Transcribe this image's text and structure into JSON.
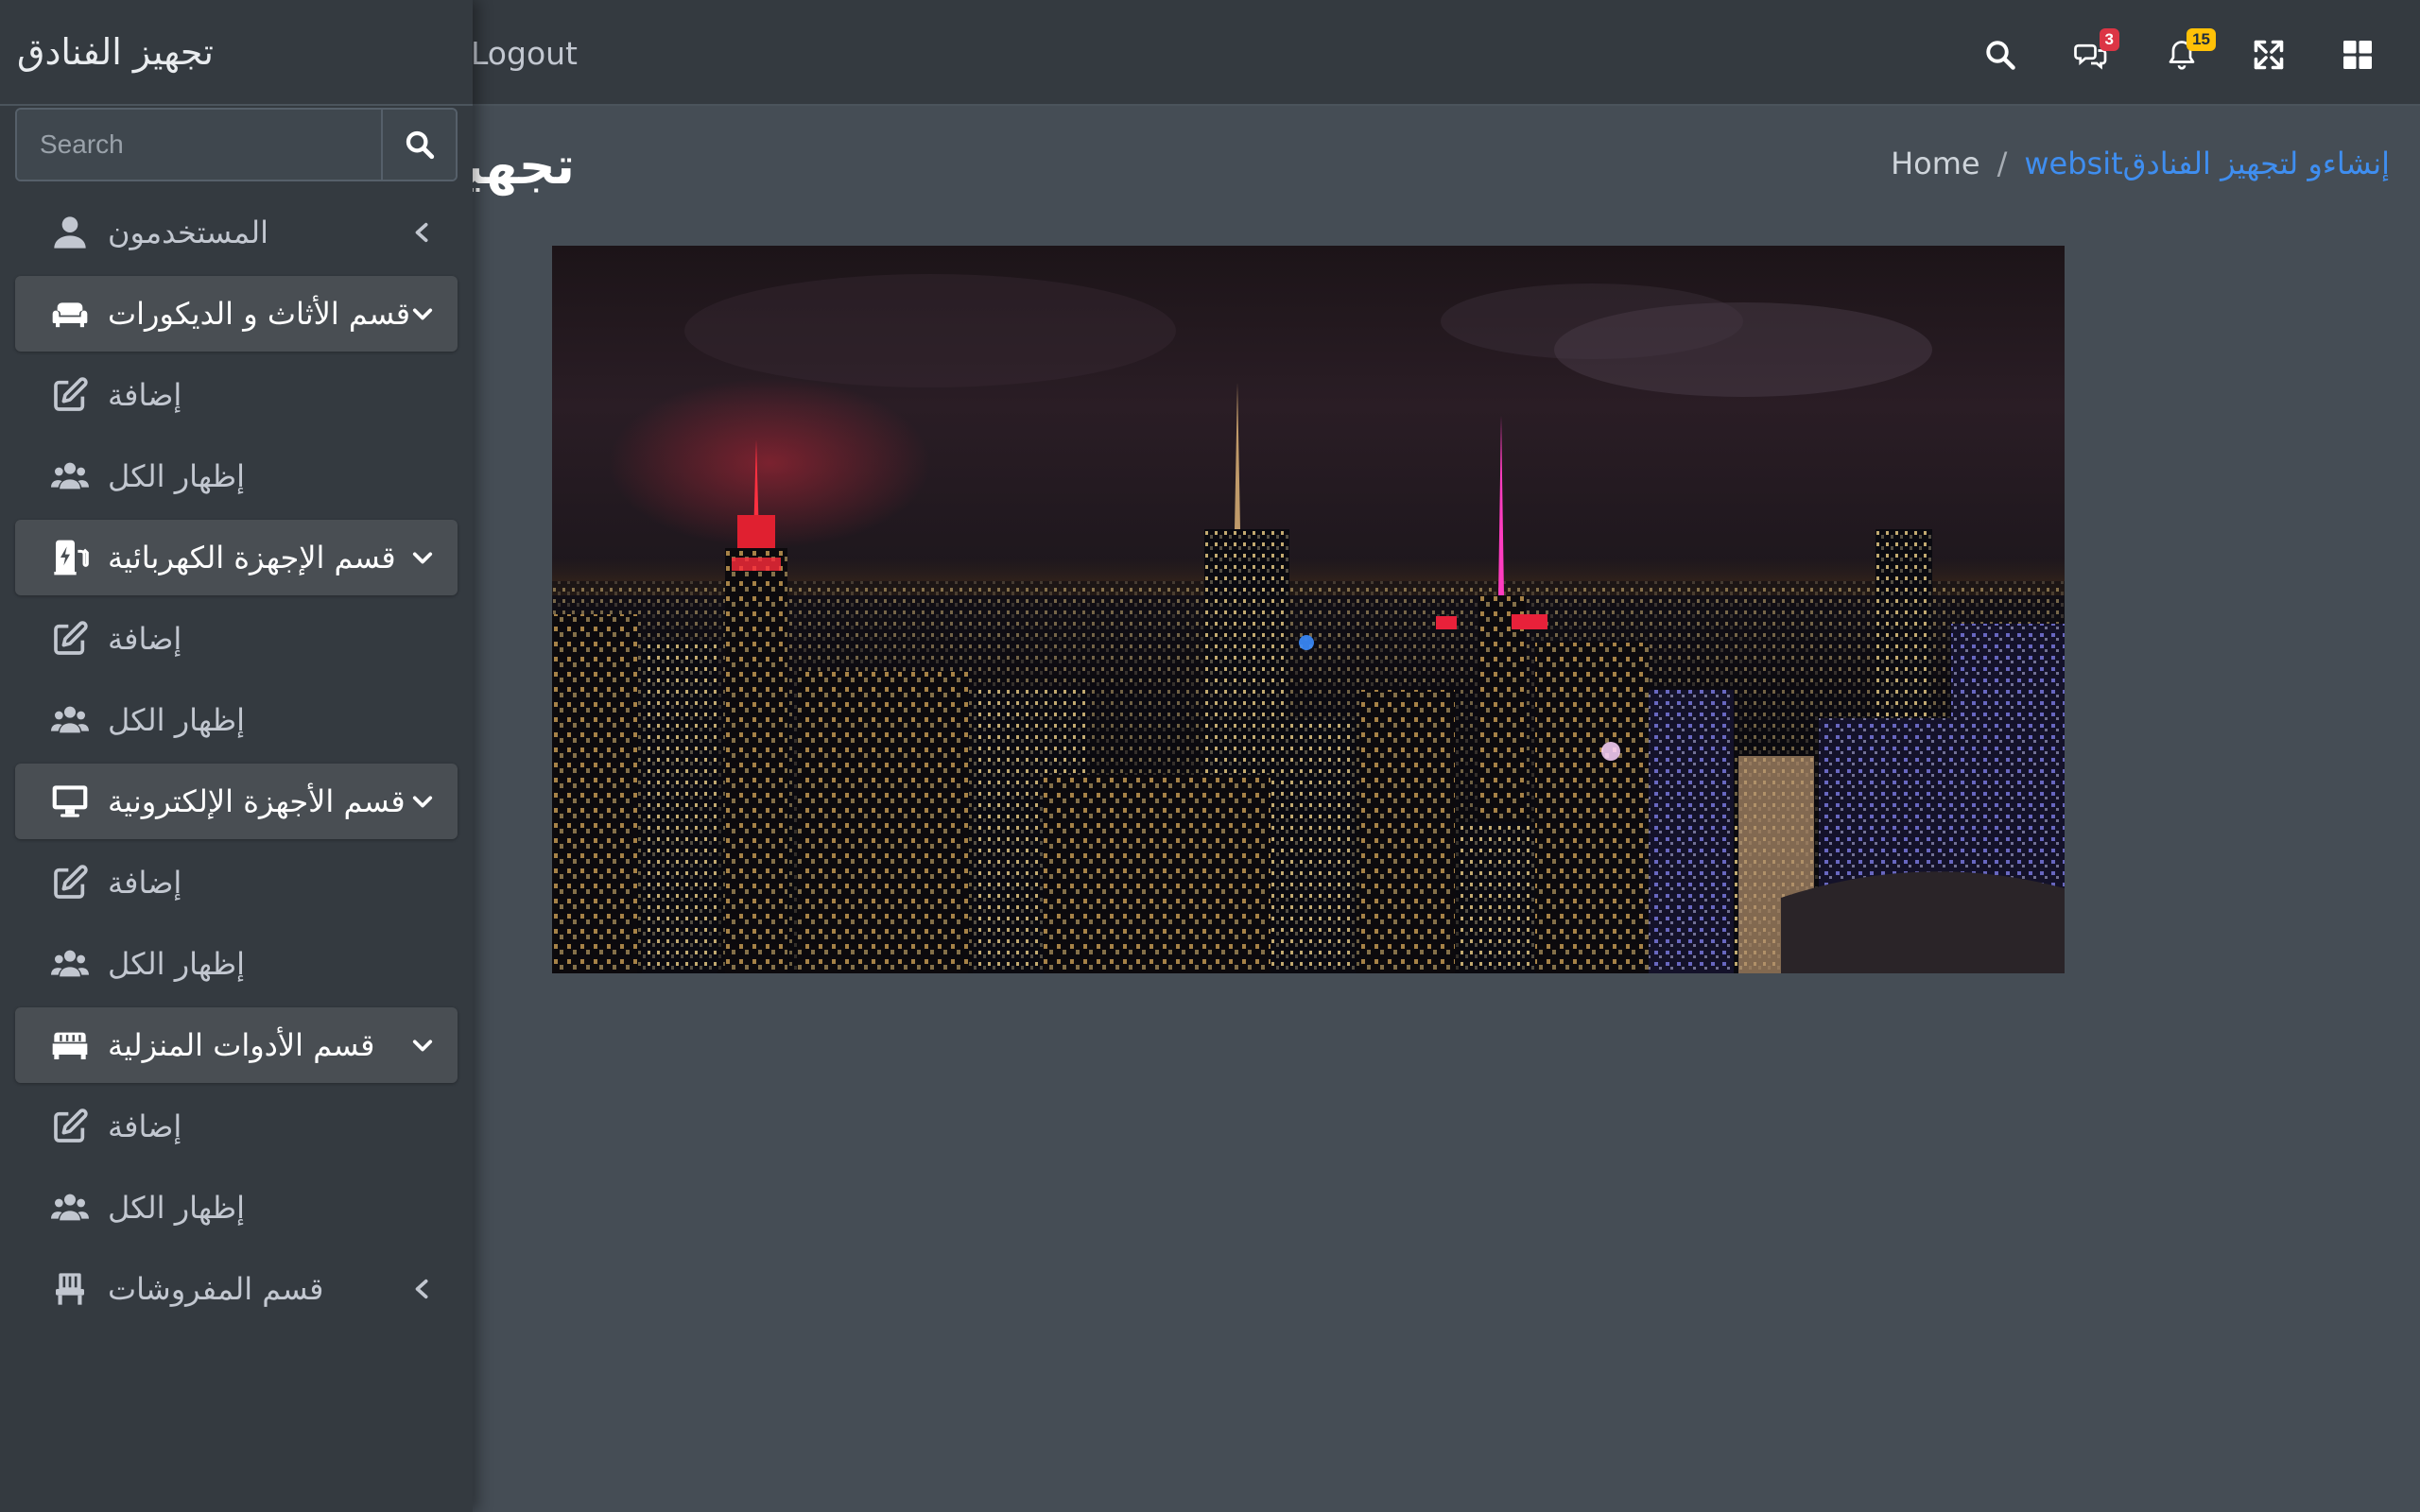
{
  "brand": {
    "title": "تجهيز الفنادق"
  },
  "search": {
    "placeholder": "Search",
    "value": ""
  },
  "navbar": {
    "logout_label": "Logout",
    "messages_count": "3",
    "notifications_count": "15"
  },
  "content": {
    "title": "تجهيز الفنادق",
    "breadcrumb": {
      "active": "websitإنشاءو لتجهيز الفنادق",
      "separator": "/",
      "home": "Home"
    }
  },
  "sidebar": {
    "items": [
      {
        "label": "المستخدمون",
        "icon": "user-icon",
        "state": "collapsed"
      },
      {
        "label": "قسم الأثاث و الديكورات",
        "icon": "couch-icon",
        "state": "open"
      },
      {
        "label": "إضافة",
        "icon": "edit-icon"
      },
      {
        "label": "إظهار الكل",
        "icon": "users-icon"
      },
      {
        "label": "قسم الإجهزة الكهربائية",
        "icon": "charging-station-icon",
        "state": "open"
      },
      {
        "label": "إضافة",
        "icon": "edit-icon"
      },
      {
        "label": "إظهار الكل",
        "icon": "users-icon"
      },
      {
        "label": "قسم الأجهزة الإلكترونية",
        "icon": "desktop-icon",
        "state": "open"
      },
      {
        "label": "إضافة",
        "icon": "edit-icon"
      },
      {
        "label": "إظهار الكل",
        "icon": "users-icon"
      },
      {
        "label": "قسم الأدوات المنزلية",
        "icon": "sofa-icon",
        "state": "open"
      },
      {
        "label": "إضافة",
        "icon": "edit-icon"
      },
      {
        "label": "إظهار الكل",
        "icon": "users-icon"
      },
      {
        "label": "قسم المفروشات",
        "icon": "chair-icon",
        "state": "collapsed"
      }
    ]
  },
  "colors": {
    "sidebar_bg": "#343a40",
    "content_bg": "#454d55",
    "open_item_bg": "#494e53",
    "link_blue": "#3f8ef0",
    "badge_red": "#dc3545",
    "badge_yellow": "#ffc107"
  }
}
